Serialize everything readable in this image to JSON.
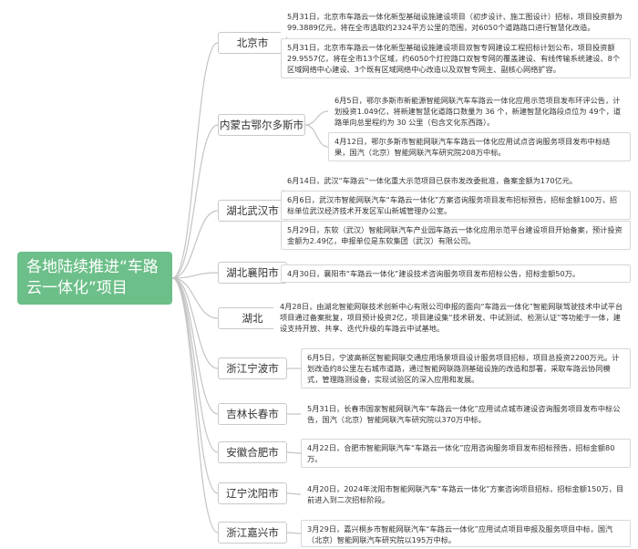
{
  "root": {
    "title": "各地陆续推进“车路云一体化”项目"
  },
  "regions": [
    {
      "name": "北京市",
      "items": [
        "5月31日，北京市车路云一体化新型基础设施建设项目（初步设计、施工图设计）招标，项目投资额为99.3889亿元，将在全市选取约2324平方公里的范围，对6050个道路路口进行智慧化改造。",
        "5月31日，北京市车路云一体化新型基础设施建设项目双智专网建设工程招标计划公布，项目投资额29.9557亿，将在全市13个区域，约6050个灯控路口双智专网的覆盖建设、有线传输系统建设、8个区域网络中心建设、3个既有区域网络中心改造以及双智专网主、副核心网络扩容。"
      ]
    },
    {
      "name": "内蒙古鄂尔多斯市",
      "items": [
        "6月5日，鄂尔多斯市新能源智能网联汽车车路云一体化应用示范项目发布环评公告，计划投资1.049亿，将新建智慧化道路口数量为 36 个，新建智慧化路段点位为 49个，道路单向总里程约为 30 公里（包含文化东西路）。",
        "4月12日，鄂尔多斯市智能网联汽车车路云一体化应用试点咨询服务项目发布中标结果，国汽（北京）智能网联汽车研究院208万中标。"
      ]
    },
    {
      "name": "湖北武汉市",
      "items": [
        "6月14日，武汉“车路云”一体化重大示范项目已获市发改委批准，备案金额为170亿元。",
        "6月6日，武汉市智能网联汽车“车路云一体化”方案咨询服务项目发布招标预告，招标金额100万，招标单位武汉经济技术开发区军山新城管理办公室。",
        "5月29日，东软（武汉）智能网联汽车产业园车路云一体化应用示范平台建设项目开始备案，预计投资金额为2.49亿，申报单位是东软集团（武汉）有限公司。"
      ]
    },
    {
      "name": "湖北襄阳市",
      "items": [
        "4月30日，襄阳市“车路云一体化”建设技术咨询服务项目发布招标公告，招标金额50万。"
      ]
    },
    {
      "name": "湖北",
      "items": [
        "4月28日，由湖北智能网联技术创新中心有限公司申报的面向“车路云一体化”智能网联驾驶技术中试平台项目通过备案批复，项目预计投资2亿，项目建设集“技术研发、中试测试、检测认证”等功能于一体，建设支持开放、共享、迭代升级的车路云中试基地。"
      ]
    },
    {
      "name": "浙江宁波市",
      "items": [
        "6月5日，宁波高新区智能网联交通应用场景项目设计服务项目招标，项目总投资2200万元。计划改造约8公里左右城市道路，通过智能网联路测基础设施的改造和部署，采取车路云协同模式，管理路测设备，实现试验区的深入应用和发展。"
      ]
    },
    {
      "name": "吉林长春市",
      "items": [
        "5月31日，长春市国家智能网联汽车“车路云一体化”应用试点城市建设咨询服务项目发布中标公告，国汽（北京）智能网联汽车研究院以370万中标。"
      ]
    },
    {
      "name": "安徽合肥市",
      "items": [
        "4月22日，合肥市智能网联汽车“车路云一体化”应用咨询服务项目发布招标预告，招标金额80万。"
      ]
    },
    {
      "name": "辽宁沈阳市",
      "items": [
        "4月20日，2024年沈阳市智能网联汽车“车路云一体化”方案咨询项目招标，招标金额150万，目前进入到二次招标阶段。"
      ]
    },
    {
      "name": "浙江嘉兴市",
      "items": [
        "3月29日，嘉兴桐乡市智能网联汽车“车路云一体化”应用试点项目申报及服务项目中标，国汽（北京）智能网联汽车研究院以195万中标。"
      ]
    }
  ],
  "colors": {
    "root": "#6cbf89",
    "line": "#c4c4c4",
    "border": "#d7d7d7"
  }
}
